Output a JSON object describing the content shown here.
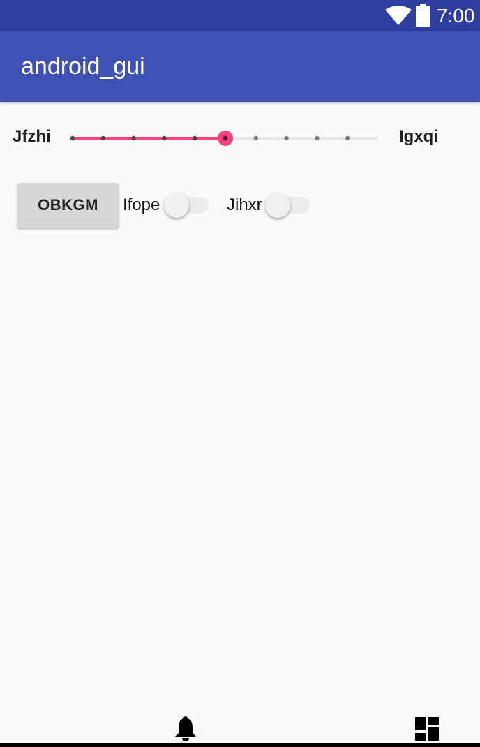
{
  "status_bar": {
    "time": "7:00",
    "wifi_icon": "wifi-icon",
    "battery_icon": "battery-icon",
    "background": "#303F9F"
  },
  "app_bar": {
    "title": "android_gui",
    "background": "#3F51B5"
  },
  "slider": {
    "left_label": "Jfzhi",
    "right_label": "Igxqi",
    "step_count": 10,
    "value_step": 5,
    "accent_color": "#FF4081"
  },
  "button": {
    "label": "OBKGM"
  },
  "switches": [
    {
      "label": "Ifope",
      "on": false
    },
    {
      "label": "Jihxr",
      "on": false
    }
  ],
  "bottom_icons": [
    "bell-icon",
    "dashboard-icon"
  ]
}
